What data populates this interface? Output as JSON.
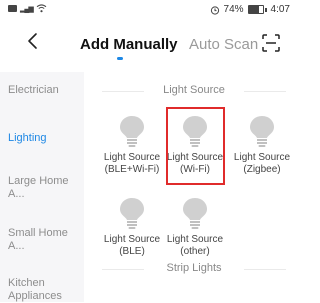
{
  "status_bar": {
    "battery_percent": "74%",
    "time": "4:07"
  },
  "header": {
    "tab_add_manually": "Add Manually",
    "tab_auto_scan": "Auto Scan"
  },
  "sidebar": {
    "items": [
      {
        "label": "Electrician"
      },
      {
        "label": "Lighting"
      },
      {
        "label": "Large Home A..."
      },
      {
        "label": "Small Home A..."
      },
      {
        "label": "Kitchen Appliances"
      }
    ]
  },
  "sections": {
    "light_source": {
      "title": "Light Source"
    },
    "strip_lights": {
      "title": "Strip Lights"
    }
  },
  "devices": [
    {
      "line1": "Light Source",
      "line2": "(BLE+Wi-Fi)"
    },
    {
      "line1": "Light Source",
      "line2": "(Wi-Fi)"
    },
    {
      "line1": "Light Source",
      "line2": "(Zigbee)"
    },
    {
      "line1": "Light Source",
      "line2": "(BLE)"
    },
    {
      "line1": "Light Source",
      "line2": "(other)"
    }
  ],
  "colors": {
    "accent": "#1e88e5",
    "highlight": "#e02b2b",
    "bulb": "#d0d0d0"
  },
  "battery_level": 0.74
}
